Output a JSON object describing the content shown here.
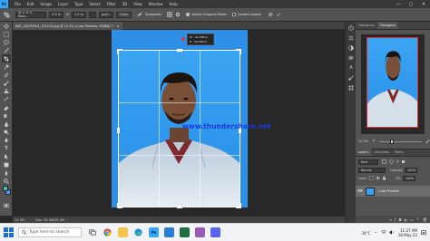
{
  "menu": {
    "app_logo": "Ps",
    "items": [
      "File",
      "Edit",
      "Image",
      "Layer",
      "Type",
      "Select",
      "Filter",
      "3D",
      "View",
      "Window",
      "Help"
    ],
    "window_controls": [
      "—",
      "▢",
      "✕"
    ]
  },
  "options": {
    "ratio_preset": "W × H × Reso...",
    "width_value": "3.5 in",
    "swap_icon": "⇄",
    "height_value": "1.5 in",
    "resolution_unit": "px/in",
    "clear_label": "Clear",
    "straighten_label": "Straighten",
    "delete_cropped_label": "Delete Cropped Pixels",
    "content_aware_label": "Content-Aware",
    "cancel_icon": "⊘",
    "commit_icon": "✓"
  },
  "tools": [
    "move-icon",
    "marquee-icon",
    "lasso-icon",
    "magic-wand-icon",
    "crop-icon",
    "eyedropper-icon",
    "healing-icon",
    "brush-icon",
    "stamp-icon",
    "history-brush-icon",
    "eraser-icon",
    "gradient-icon",
    "blur-icon",
    "dodge-icon",
    "pen-icon",
    "type-icon",
    "path-select-icon",
    "shape-icon",
    "hand-icon",
    "zoom-icon"
  ],
  "colors": {
    "foreground": "#4fb6c6",
    "background": "#3ba4f2",
    "accent": "#31a8ff",
    "watermark": "#1a3bd9"
  },
  "document": {
    "tab_title": "IMG_20230914_121214.jpg @ 12.5% (Crop Preview, RGB/8) *",
    "tab_close": "×",
    "crop_tooltip_w": "W : 41.289 in",
    "crop_tooltip_h": "H : 53.084 in",
    "watermark_text": "www.thundershare.net"
  },
  "status": {
    "zoom": "12.5%",
    "doc_info": "Doc: 35.4M/35.4M"
  },
  "panels": {
    "top_tabs": [
      "Histogram",
      "Navigator"
    ],
    "zoom_level": "12.5%",
    "layers_tabs": [
      "Layers",
      "Channels",
      "Paths"
    ],
    "kind_label": "Kind",
    "blend_mode": "Normal",
    "opacity_label": "Opacity:",
    "opacity_value": "100%",
    "lock_label": "Lock:",
    "fill_label": "Fill:",
    "fill_value": "100%",
    "layer_name": "Crop Preview"
  },
  "taskbar": {
    "search_placeholder": "Type here to search",
    "time": "11:27 AM",
    "date": "18-May-22",
    "weather": "34°C"
  }
}
